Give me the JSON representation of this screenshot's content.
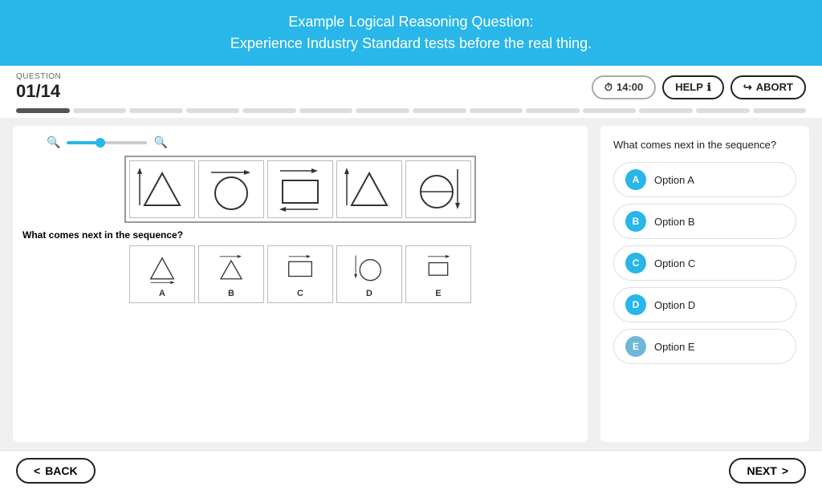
{
  "header": {
    "title_line1": "Example Logical Reasoning Question:",
    "title_line2": "Experience Industry Standard tests before the real thing."
  },
  "question_bar": {
    "label": "QUESTION",
    "number": "01/14",
    "timer": "14:00",
    "help_label": "HELP",
    "abort_label": "ABORT"
  },
  "progress": {
    "total": 14,
    "active": 1
  },
  "left_panel": {
    "sequence_question": "What comes next in the sequence?",
    "answer_row_question": "What comes next in the sequence?",
    "option_labels": [
      "A",
      "B",
      "C",
      "D",
      "E"
    ]
  },
  "right_panel": {
    "question": "What comes next in the sequence?",
    "options": [
      {
        "letter": "A",
        "label": "Option A"
      },
      {
        "letter": "B",
        "label": "Option B"
      },
      {
        "letter": "C",
        "label": "Option C"
      },
      {
        "letter": "D",
        "label": "Option D"
      },
      {
        "letter": "E",
        "label": "Option E"
      }
    ]
  },
  "nav": {
    "back_label": "BACK",
    "next_label": "NEXT"
  },
  "icons": {
    "timer": "⏱",
    "help_info": "ℹ",
    "abort_arrow": "↪",
    "back_arrow": "<",
    "next_arrow": ">"
  }
}
